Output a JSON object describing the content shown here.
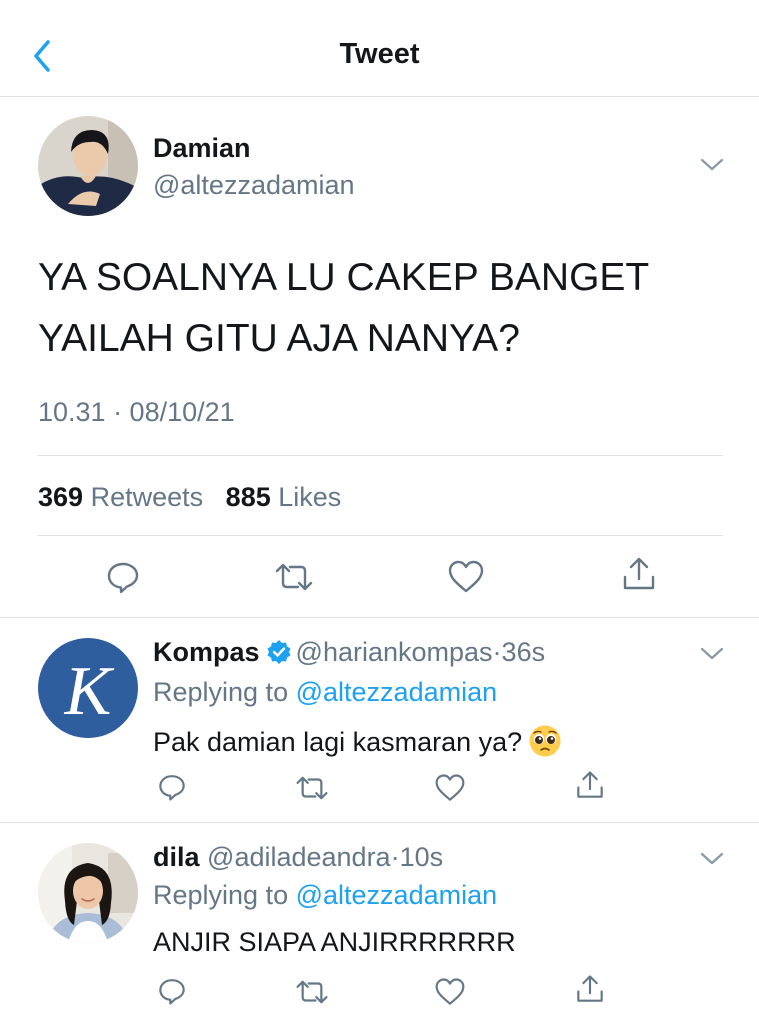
{
  "header": {
    "title": "Tweet",
    "back_icon": "chevron-left-icon",
    "accent": "#1da1f2"
  },
  "main_tweet": {
    "author_name": "Damian",
    "author_handle": "@altezzadamian",
    "text_line1": "YA SOALNYA LU CAKEP BANGET",
    "text_line2": "YAILAH GITU AJA NANYA?",
    "timestamp": "10.31 · 08/10/21",
    "retweets_count": "369",
    "retweets_label": "Retweets",
    "likes_count": "885",
    "likes_label": "Likes",
    "actions": [
      "reply-icon",
      "retweet-icon",
      "like-icon",
      "share-icon"
    ]
  },
  "replies": [
    {
      "name": "Kompas",
      "verified": true,
      "handle": "@hariankompas",
      "separator": "·",
      "time": "36s",
      "replying_prefix": "Replying to",
      "replying_to": "@altezzadamian",
      "text": "Pak damian lagi kasmaran ya?",
      "emoji": "pleading-face-emoji",
      "avatar_letter": "K",
      "avatar_color": "#2f5e9e"
    },
    {
      "name": "dila",
      "verified": false,
      "handle": "@adiladeandra",
      "separator": "·",
      "time": "10s",
      "replying_prefix": "Replying to",
      "replying_to": "@altezzadamian",
      "text": "ANJIR SIAPA ANJIRRRRRRR"
    }
  ],
  "colors": {
    "text_primary": "#14171a",
    "text_secondary": "#657786",
    "link": "#1da1f2",
    "divider": "#dfe3e7"
  }
}
